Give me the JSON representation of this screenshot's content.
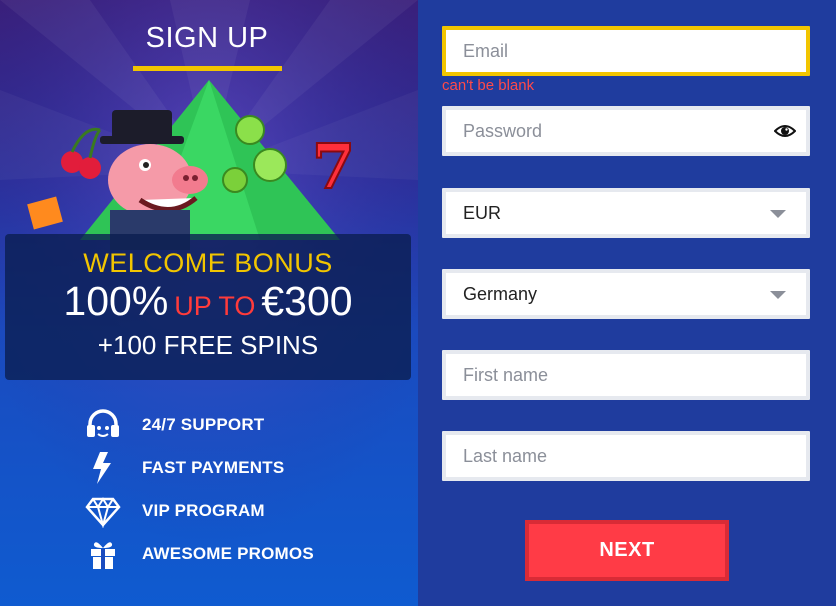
{
  "header": {
    "title": "SIGN UP"
  },
  "bonus": {
    "line1": "WELCOME BONUS",
    "percent": "100%",
    "up_to": "UP TO",
    "amount": "€300",
    "line3": "+100 FREE SPINS"
  },
  "features": [
    {
      "icon": "headset-icon",
      "label": "24/7 SUPPORT"
    },
    {
      "icon": "lightning-icon",
      "label": "FAST PAYMENTS"
    },
    {
      "icon": "diamond-icon",
      "label": "VIP PROGRAM"
    },
    {
      "icon": "gift-icon",
      "label": "AWESOME PROMOS"
    }
  ],
  "form": {
    "email": {
      "placeholder": "Email",
      "value": "",
      "error": "can't be blank"
    },
    "password": {
      "placeholder": "Password",
      "value": ""
    },
    "currency": {
      "value": "EUR"
    },
    "country": {
      "value": "Germany"
    },
    "first_name": {
      "placeholder": "First name",
      "value": ""
    },
    "last_name": {
      "placeholder": "Last name",
      "value": ""
    },
    "next_label": "NEXT"
  },
  "colors": {
    "accent_yellow": "#f2c500",
    "button_red": "#ff3b46",
    "error_red": "#ff4a4a",
    "right_bg": "#1f3c9e"
  }
}
